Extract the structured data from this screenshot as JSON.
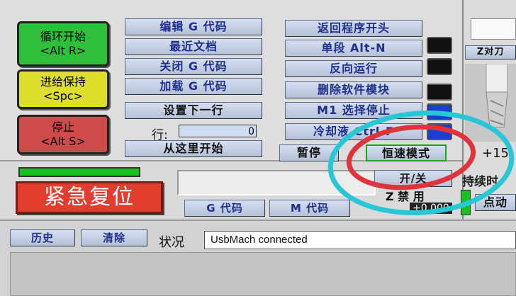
{
  "left_buttons": {
    "cycle_start": {
      "line1": "循环开始",
      "line2": "<Alt R>"
    },
    "feed_hold": {
      "line1": "进给保持",
      "line2": "<Spc>"
    },
    "stop": {
      "line1": "停止",
      "line2": "<Alt S>"
    }
  },
  "col1": {
    "edit_gcode": "编辑 G 代码",
    "recent_files": "最近文档",
    "close_gcode": "关闭 G 代码",
    "load_gcode": "加载 G 代码",
    "set_next_line": "设置下一行",
    "line_label": "行:",
    "line_value": "0",
    "run_from_here": "从这里开始"
  },
  "col2": {
    "rewind": "返回程序开头",
    "single_block": "单段 Alt-N",
    "reverse_run": "反向运行",
    "block_delete": "删除软件模块",
    "m1_optional_stop": "M1 选择停止",
    "coolant": "冷却液 Ctrl-F",
    "pause": "暂停",
    "constant_velocity": "恒速模式"
  },
  "mid": {
    "estop": "紧急复位",
    "toggle": "开/关",
    "z_inhibit": "Z 禁 用",
    "z_value": "+0.000",
    "g_codes": "G 代码",
    "m_codes": "M 代码"
  },
  "right_panel": {
    "z_touch": "Z对刀",
    "value": "+15",
    "persist": "持续时",
    "jog": "点动"
  },
  "bottom": {
    "history": "历史",
    "clear": "清除",
    "status_label": "状况",
    "status_value": "UsbMach connected"
  },
  "colors": {
    "annotation_cyan": "#29c6d6",
    "annotation_red": "#e0343c",
    "led_blue": "#1840d0"
  }
}
